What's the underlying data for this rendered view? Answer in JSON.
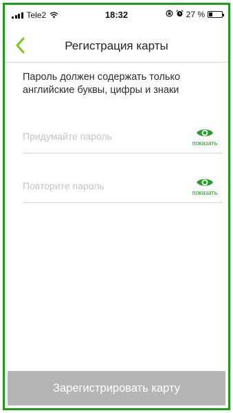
{
  "status_bar": {
    "carrier": "Tele2",
    "time": "18:32",
    "battery_percent": "27 %",
    "battery_level": 0.27,
    "icons": [
      "signal-icon",
      "wifi-icon",
      "rotation-lock-icon",
      "alarm-icon",
      "battery-icon"
    ]
  },
  "header": {
    "title": "Регистрация карты",
    "back_icon": "chevron-left-icon"
  },
  "main": {
    "info_text": "Пароль должен содержать только английские буквы, цифры и знаки",
    "password_field": {
      "value": "",
      "placeholder": "Придумайте пароль",
      "toggle_label": "показать"
    },
    "repeat_field": {
      "value": "",
      "placeholder": "Повторите пароль",
      "toggle_label": "показать"
    }
  },
  "footer": {
    "register_button_label": "Зарегистрировать карту"
  },
  "colors": {
    "accent": "#2e9b2e",
    "frame_border": "#1f9a1f",
    "button_disabled": "#b5b5b5"
  }
}
